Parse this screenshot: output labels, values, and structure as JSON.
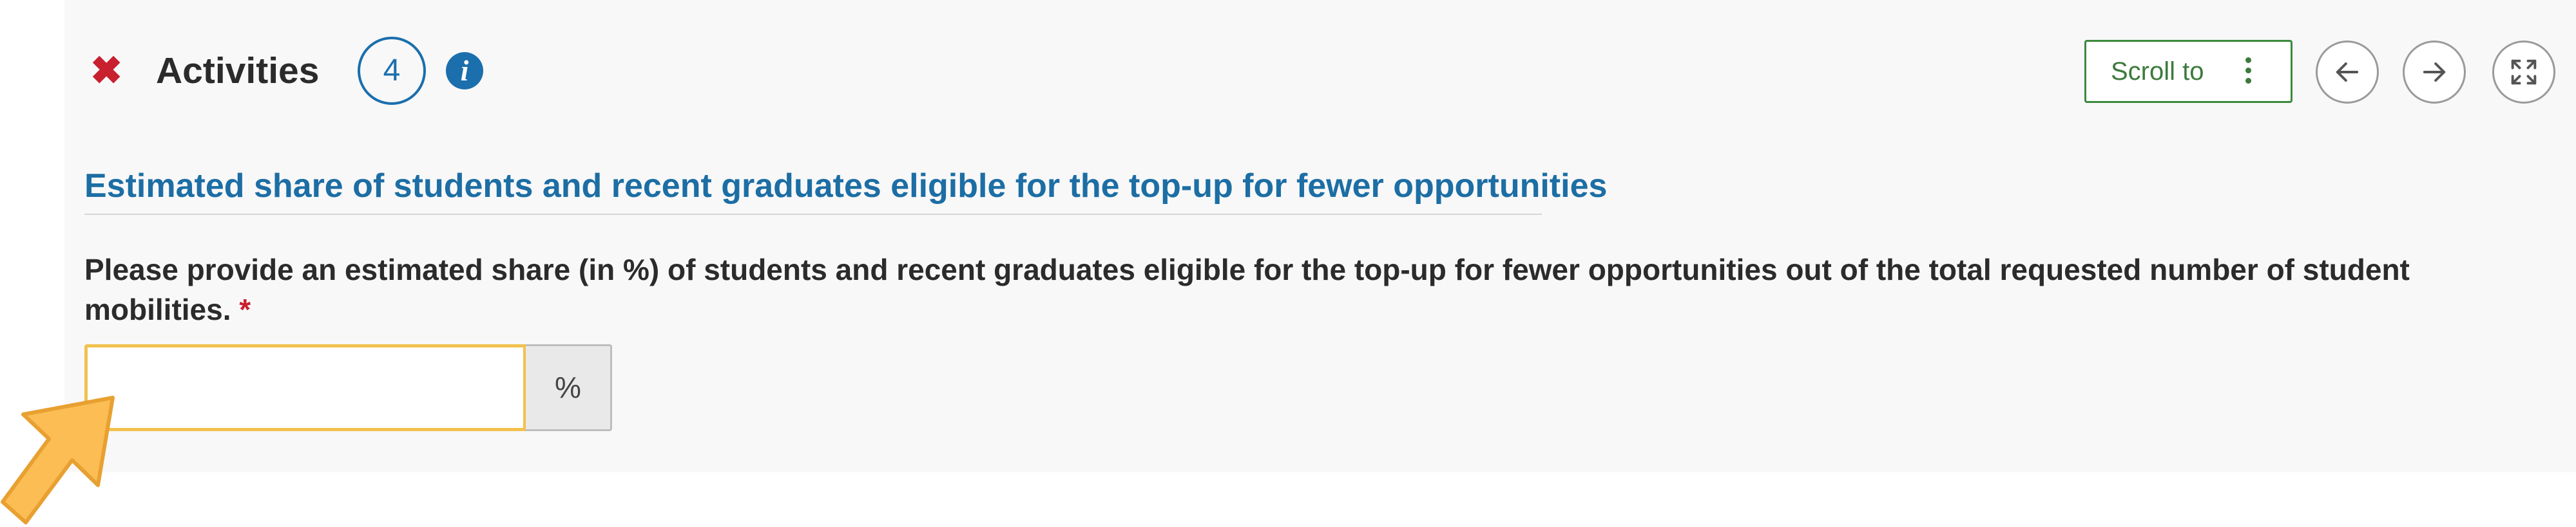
{
  "header": {
    "close_glyph": "✖",
    "title": "Activities",
    "count": "4",
    "info_glyph": "i",
    "scroll_to_label": "Scroll to"
  },
  "section": {
    "subtitle": "Estimated share of students and recent graduates eligible for the top-up for fewer opportunities",
    "question": "Please provide an estimated share (in %) of students and recent graduates eligible for the top-up for fewer opportunities out of the total requested number of student mobilities.",
    "required_mark": "*",
    "input_value": "",
    "unit": "%"
  },
  "icons": {
    "close": "close-icon",
    "info": "info-icon",
    "more": "kebab-icon",
    "previous": "arrow-left-icon",
    "next": "arrow-right-icon",
    "fullscreen": "expand-icon",
    "pointer": "pointer-arrow-icon"
  },
  "colors": {
    "accent_blue": "#1b6fad",
    "close_red": "#c8202e",
    "scroll_green": "#3c8a3c",
    "focus_yellow": "#f2c14e",
    "pointer_orange": "#fbbd54",
    "panel_bg": "#f8f8f8"
  }
}
